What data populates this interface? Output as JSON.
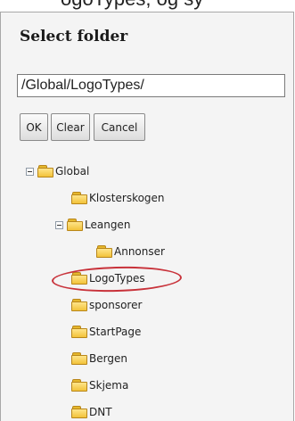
{
  "page_top_text": "ogoTypes, og sy",
  "dialog": {
    "title": "Select folder",
    "path_value": "/Global/LogoTypes/",
    "buttons": {
      "ok": "OK",
      "clear": "Clear",
      "cancel": "Cancel"
    },
    "tree": {
      "global": "Global",
      "klosterskogen": "Klosterskogen",
      "leangen": "Leangen",
      "annonser": "Annonser",
      "logotypes": "LogoTypes",
      "sponsorer": "sponsorer",
      "startpage": "StartPage",
      "bergen": "Bergen",
      "skjema": "Skjema",
      "dnt": "DNT"
    },
    "selected_folder": "LogoTypes"
  },
  "colors": {
    "highlight": "#c8323a",
    "folder": "#f2c23a"
  }
}
